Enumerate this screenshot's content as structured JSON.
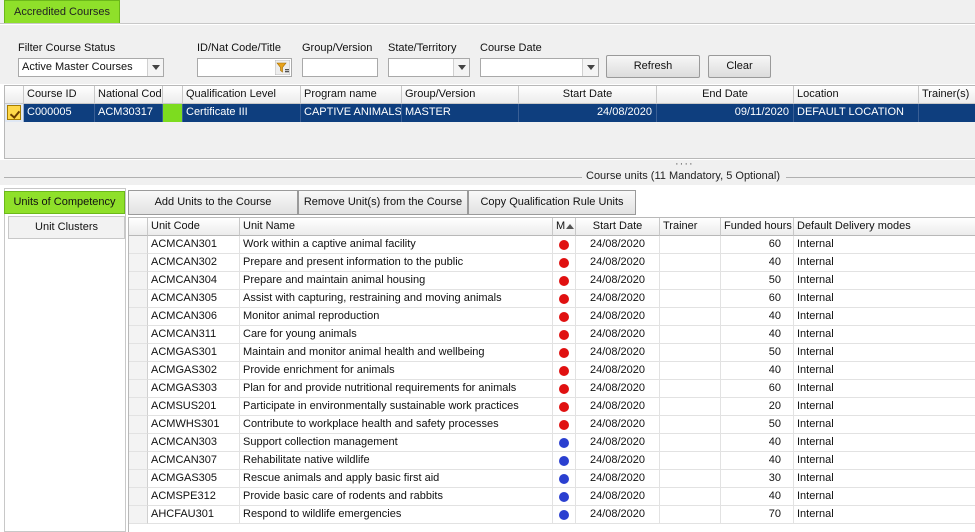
{
  "top_tab": "Accredited Courses",
  "filters": {
    "status_label": "Filter Course Status",
    "status_value": "Active Master Courses",
    "id_label": "ID/Nat Code/Title",
    "id_value": "",
    "group_label": "Group/Version",
    "group_value": "",
    "state_label": "State/Territory",
    "state_value": "",
    "date_label": "Course Date",
    "date_value": "",
    "refresh_label": "Refresh",
    "clear_label": "Clear"
  },
  "courses": {
    "columns": [
      "Course ID",
      "National Code",
      "",
      "Qualification Level",
      "Program name",
      "Group/Version",
      "Start Date",
      "End Date",
      "Location",
      "Trainer(s)"
    ],
    "rows": [
      {
        "course_id": "C000005",
        "national_code": "ACM30317",
        "status_color": "#7ddc1f",
        "qualification": "Certificate III",
        "program": "CAPTIVE ANIMALS",
        "group": "MASTER",
        "start": "24/08/2020",
        "end": "09/11/2020",
        "location": "DEFAULT LOCATION",
        "trainer": ""
      }
    ]
  },
  "course_units_label": "Course units (11 Mandatory, 5 Optional)",
  "left_tabs": [
    "Units of Competency",
    "Unit Clusters"
  ],
  "actions": [
    "Add Units to the Course",
    "Remove Unit(s) from the Course",
    "Copy Qualification Rule Units"
  ],
  "units": {
    "columns": [
      "Unit Code",
      "Unit Name",
      "M",
      "Start Date",
      "Trainer",
      "Funded hours",
      "Default Delivery modes"
    ],
    "colors": {
      "mandatory": "#e01010",
      "optional": "#2a3fd0"
    },
    "rows": [
      {
        "code": "ACMCAN301",
        "name": "Work within a captive animal facility",
        "type": "mandatory",
        "start": "24/08/2020",
        "trainer": "",
        "hours": "60",
        "mode": "Internal"
      },
      {
        "code": "ACMCAN302",
        "name": "Prepare and present information to the public",
        "type": "mandatory",
        "start": "24/08/2020",
        "trainer": "",
        "hours": "40",
        "mode": "Internal"
      },
      {
        "code": "ACMCAN304",
        "name": "Prepare and maintain animal housing",
        "type": "mandatory",
        "start": "24/08/2020",
        "trainer": "",
        "hours": "50",
        "mode": "Internal"
      },
      {
        "code": "ACMCAN305",
        "name": "Assist with capturing, restraining and moving animals",
        "type": "mandatory",
        "start": "24/08/2020",
        "trainer": "",
        "hours": "60",
        "mode": "Internal"
      },
      {
        "code": "ACMCAN306",
        "name": "Monitor animal reproduction",
        "type": "mandatory",
        "start": "24/08/2020",
        "trainer": "",
        "hours": "40",
        "mode": "Internal"
      },
      {
        "code": "ACMCAN311",
        "name": "Care for young animals",
        "type": "mandatory",
        "start": "24/08/2020",
        "trainer": "",
        "hours": "40",
        "mode": "Internal"
      },
      {
        "code": "ACMGAS301",
        "name": "Maintain and monitor animal health and wellbeing",
        "type": "mandatory",
        "start": "24/08/2020",
        "trainer": "",
        "hours": "50",
        "mode": "Internal"
      },
      {
        "code": "ACMGAS302",
        "name": "Provide enrichment for animals",
        "type": "mandatory",
        "start": "24/08/2020",
        "trainer": "",
        "hours": "40",
        "mode": "Internal"
      },
      {
        "code": "ACMGAS303",
        "name": "Plan for and provide nutritional requirements for animals",
        "type": "mandatory",
        "start": "24/08/2020",
        "trainer": "",
        "hours": "60",
        "mode": "Internal"
      },
      {
        "code": "ACMSUS201",
        "name": "Participate in environmentally sustainable work practices",
        "type": "mandatory",
        "start": "24/08/2020",
        "trainer": "",
        "hours": "20",
        "mode": "Internal"
      },
      {
        "code": "ACMWHS301",
        "name": "Contribute to workplace health and safety processes",
        "type": "mandatory",
        "start": "24/08/2020",
        "trainer": "",
        "hours": "50",
        "mode": "Internal"
      },
      {
        "code": "ACMCAN303",
        "name": "Support collection management",
        "type": "optional",
        "start": "24/08/2020",
        "trainer": "",
        "hours": "40",
        "mode": "Internal"
      },
      {
        "code": "ACMCAN307",
        "name": "Rehabilitate native wildlife",
        "type": "optional",
        "start": "24/08/2020",
        "trainer": "",
        "hours": "40",
        "mode": "Internal"
      },
      {
        "code": "ACMGAS305",
        "name": "Rescue animals and apply basic first aid",
        "type": "optional",
        "start": "24/08/2020",
        "trainer": "",
        "hours": "30",
        "mode": "Internal"
      },
      {
        "code": "ACMSPE312",
        "name": "Provide basic care of rodents and rabbits",
        "type": "optional",
        "start": "24/08/2020",
        "trainer": "",
        "hours": "40",
        "mode": "Internal"
      },
      {
        "code": "AHCFAU301",
        "name": "Respond to wildlife emergencies",
        "type": "optional",
        "start": "24/08/2020",
        "trainer": "",
        "hours": "70",
        "mode": "Internal"
      }
    ]
  }
}
